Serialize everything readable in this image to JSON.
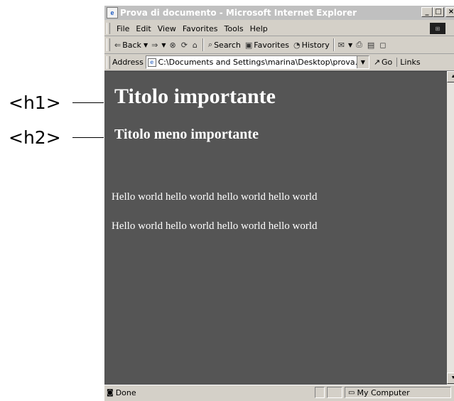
{
  "annotations": [
    {
      "tag": "<h1>"
    },
    {
      "tag": "<h2>"
    }
  ],
  "window": {
    "title": "Prova di documento - Microsoft Internet Explorer",
    "buttons": {
      "minimize": "_",
      "maximize": "□",
      "close": "×"
    }
  },
  "menubar": {
    "items": [
      "File",
      "Edit",
      "View",
      "Favorites",
      "Tools",
      "Help"
    ]
  },
  "toolbar": {
    "back": "Back",
    "search": "Search",
    "favorites": "Favorites",
    "history": "History"
  },
  "addressbar": {
    "label": "Address",
    "value": "C:\\Documents and Settings\\marina\\Desktop\\prova.html",
    "go": "Go",
    "links": "Links"
  },
  "content": {
    "background": "#555555",
    "h1": "Titolo importante",
    "h2": "Titolo meno importante",
    "paragraphs": [
      "Hello world hello world hello world hello world",
      "Hello world hello world hello world hello world"
    ]
  },
  "statusbar": {
    "status": "Done",
    "zone": "My Computer"
  }
}
